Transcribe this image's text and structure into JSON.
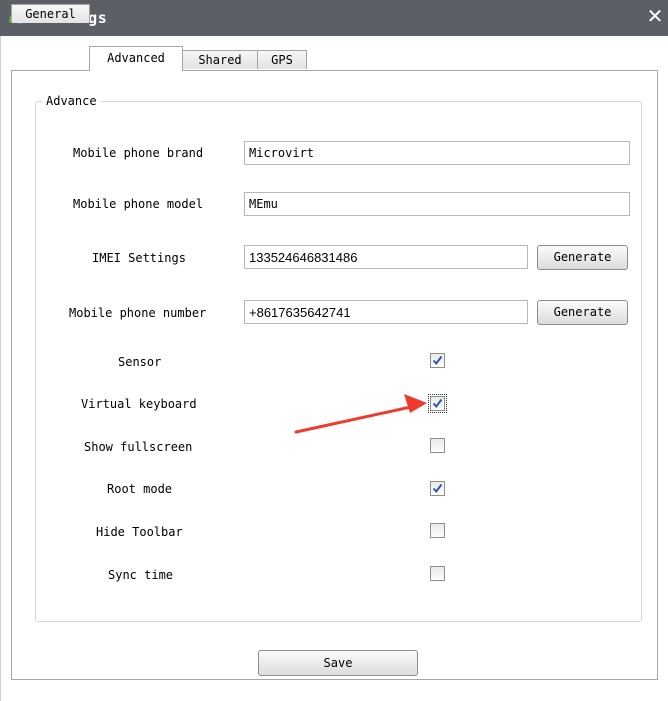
{
  "window": {
    "title": "Settings",
    "close_glyph": "✕",
    "app_icon": "pinwheel-icon"
  },
  "tabs": [
    {
      "label": "General",
      "active": false
    },
    {
      "label": "Advanced",
      "active": true
    },
    {
      "label": "Shared",
      "active": false
    },
    {
      "label": "GPS",
      "active": false
    }
  ],
  "group": {
    "legend": "Advance"
  },
  "fields": {
    "brand": {
      "label": "Mobile phone brand",
      "value": "Microvirt"
    },
    "model": {
      "label": "Mobile phone model",
      "value": "MEmu"
    },
    "imei": {
      "label": "IMEI Settings",
      "value": "133524646831486",
      "button": "Generate"
    },
    "number": {
      "label": "Mobile phone number",
      "value": "+8617635642741",
      "button": "Generate"
    }
  },
  "options": [
    {
      "label": "Sensor",
      "checked": true
    },
    {
      "label": "Virtual keyboard",
      "checked": true
    },
    {
      "label": "Show fullscreen",
      "checked": false
    },
    {
      "label": "Root mode",
      "checked": true
    },
    {
      "label": "Hide Toolbar",
      "checked": false
    },
    {
      "label": "Sync time",
      "checked": false
    }
  ],
  "save_label": "Save",
  "colors": {
    "titlebar": "#5c5f66",
    "annotation_arrow": "#f03a2e",
    "check": "#2b5aa7"
  }
}
